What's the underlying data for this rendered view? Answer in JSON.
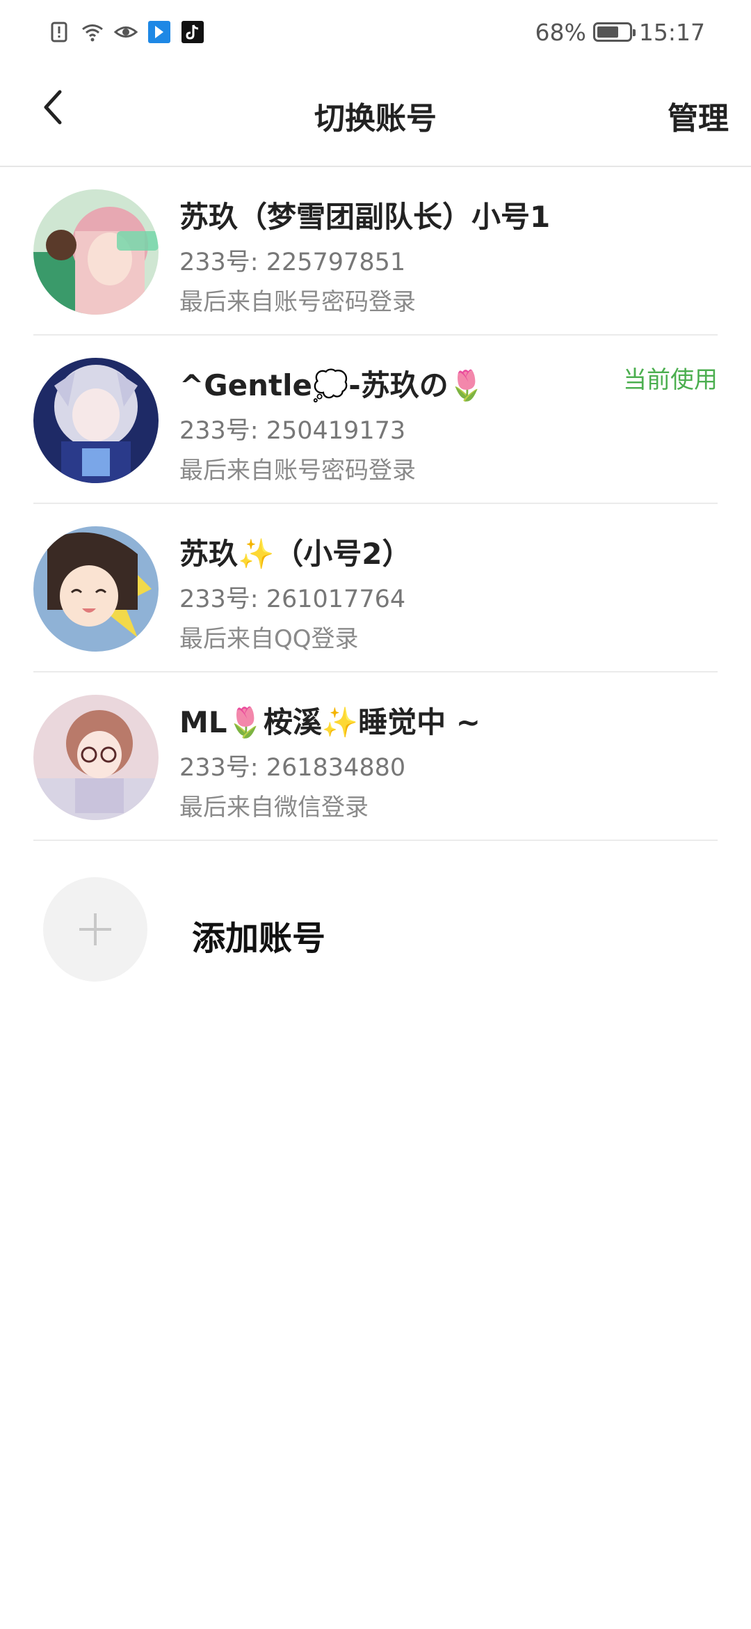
{
  "status_bar": {
    "battery_percent_text": "68%",
    "battery_level": 0.68,
    "time": "15:17",
    "icons": [
      "alert-icon",
      "wifi-icon",
      "eye-icon",
      "app-icon",
      "tiktok-icon"
    ]
  },
  "nav": {
    "title": "切换账号",
    "manage_label": "管理",
    "back_icon": "chevron-left-icon"
  },
  "accounts": [
    {
      "name": "苏玖（梦雪团副队长）小号1",
      "id_text": "233号: 225797851",
      "login_text": "最后来自账号密码登录",
      "current": ""
    },
    {
      "name": "^Gentle💭-苏玖の🌷",
      "id_text": "233号: 250419173",
      "login_text": "最后来自账号密码登录",
      "current": "当前使用"
    },
    {
      "name": "苏玖✨（小号2）",
      "id_text": "233号: 261017764",
      "login_text": "最后来自QQ登录",
      "current": ""
    },
    {
      "name": "ML🌷桉溪✨睡觉中 ~",
      "id_text": "233号: 261834880",
      "login_text": "最后来自微信登录",
      "current": ""
    }
  ],
  "add_account": {
    "label": "添加账号",
    "icon": "plus-icon"
  },
  "colors": {
    "accent_green": "#4caf50",
    "divider": "#ebebeb",
    "add_circle_bg": "#f2f2f2"
  }
}
